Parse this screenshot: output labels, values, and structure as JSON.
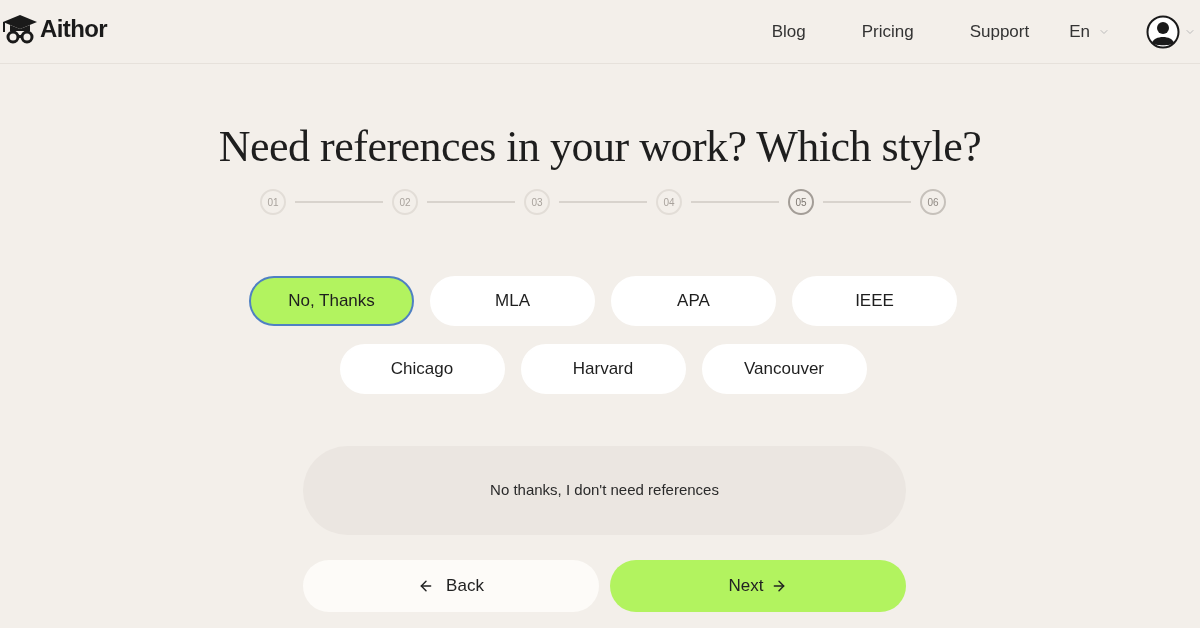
{
  "header": {
    "logo": {
      "text": "Aithor"
    },
    "nav": [
      {
        "label": "Blog"
      },
      {
        "label": "Pricing"
      },
      {
        "label": "Support"
      }
    ],
    "language": {
      "label": "En"
    }
  },
  "question": {
    "title": "Need references in your work? Which style?"
  },
  "steps": [
    {
      "label": "01",
      "completed": true,
      "selected": false
    },
    {
      "label": "02",
      "completed": true,
      "selected": false
    },
    {
      "label": "03",
      "completed": true,
      "selected": false
    },
    {
      "label": "04",
      "completed": true,
      "selected": false
    },
    {
      "label": "05",
      "completed": false,
      "selected": true
    },
    {
      "label": "06",
      "completed": false,
      "selected": false
    }
  ],
  "options": [
    {
      "label": "No, Thanks",
      "selected": true
    },
    {
      "label": "MLA",
      "selected": false
    },
    {
      "label": "APA",
      "selected": false
    },
    {
      "label": "IEEE",
      "selected": false
    },
    {
      "label": "Chicago",
      "selected": false
    },
    {
      "label": "Harvard",
      "selected": false
    },
    {
      "label": "Vancouver",
      "selected": false
    }
  ],
  "description": "No thanks, I don't need references",
  "buttons": [
    {
      "label": "Back",
      "kind": "back"
    },
    {
      "label": "Next",
      "kind": "next"
    }
  ]
}
